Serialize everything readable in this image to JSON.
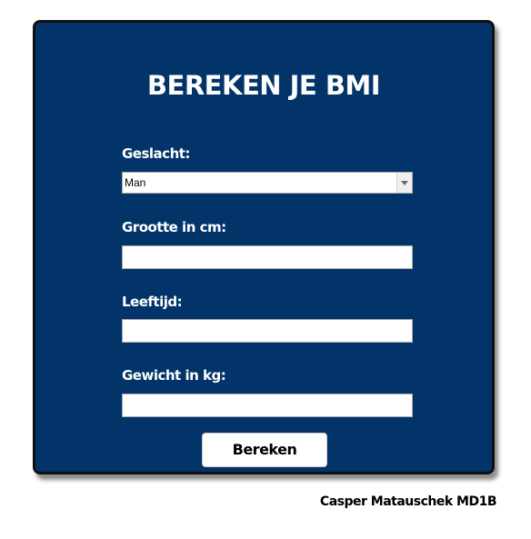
{
  "form": {
    "title": "BEREKEN JE BMI",
    "fields": {
      "gender": {
        "label": "Geslacht:",
        "value": "Man"
      },
      "height": {
        "label": "Grootte in cm:",
        "value": ""
      },
      "age": {
        "label": "Leeftijd:",
        "value": ""
      },
      "weight": {
        "label": "Gewicht in kg:",
        "value": ""
      }
    },
    "submit_label": "Bereken"
  },
  "footer": {
    "author": "Casper Matauschek MD1B"
  },
  "colors": {
    "panel_background": "#02346a",
    "panel_border": "#111111",
    "text": "#ffffff"
  },
  "icons": {
    "select_arrow": "chevron-down-icon"
  }
}
